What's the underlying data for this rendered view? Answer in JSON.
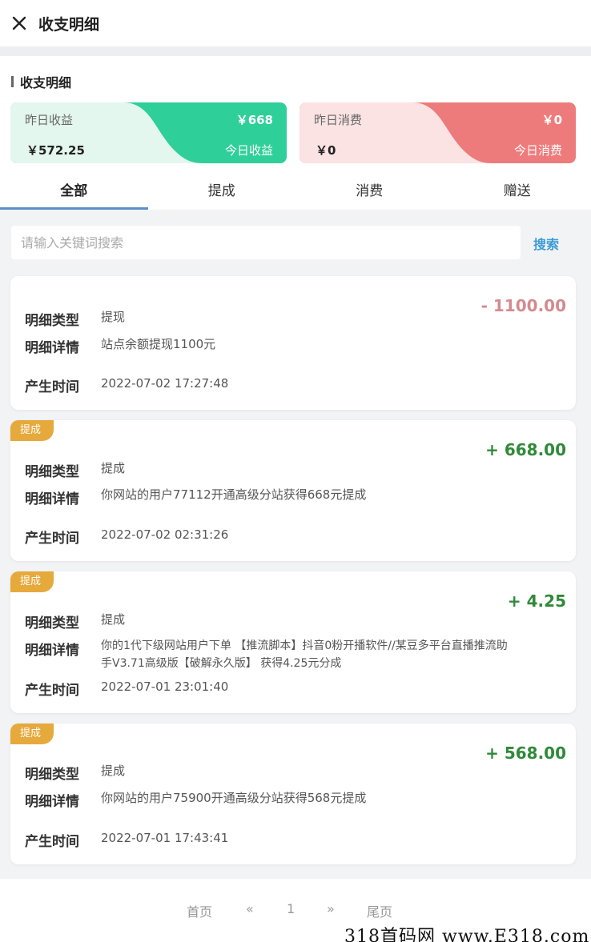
{
  "header": {
    "title": "收支明细",
    "close_icon": "close-icon"
  },
  "summary": {
    "section_title": "收支明细",
    "income_card": {
      "yesterday_label": "昨日收益",
      "yesterday_value": "￥572.25",
      "today_value": "￥668",
      "today_label": "今日收益",
      "color": "#2fcf99"
    },
    "expense_card": {
      "yesterday_label": "昨日消费",
      "yesterday_value": "￥0",
      "today_value": "￥0",
      "today_label": "今日消费",
      "color": "#ee7b7b"
    }
  },
  "tabs": [
    {
      "label": "全部",
      "active": true
    },
    {
      "label": "提成",
      "active": false
    },
    {
      "label": "消费",
      "active": false
    },
    {
      "label": "赠送",
      "active": false
    }
  ],
  "search": {
    "placeholder": "请输入关键词搜索",
    "value": "",
    "button_label": "搜索"
  },
  "field_labels": {
    "type": "明细类型",
    "detail": "明细详情",
    "time": "产生时间"
  },
  "records": [
    {
      "tag": "",
      "amount": "- 1100.00",
      "type": "提现",
      "detail": "站点余额提现1100元",
      "time": "2022-07-02 17:27:48"
    },
    {
      "tag": "提成",
      "amount": "+ 668.00",
      "type": "提成",
      "detail": "你网站的用户77112开通高级分站获得668元提成",
      "time": "2022-07-02 02:31:26"
    },
    {
      "tag": "提成",
      "amount": "+ 4.25",
      "type": "提成",
      "detail_line1": "你的1代下级网站用户下单 【推流脚本】抖音0粉开播软件//某豆多平台直播推流助",
      "detail_line2": "手V3.71高级版【破解永久版】 获得4.25元分成",
      "time": "2022-07-01 23:01:40"
    },
    {
      "tag": "提成",
      "amount": "+ 568.00",
      "type": "提成",
      "detail": "你网站的用户75900开通高级分站获得568元提成",
      "time": "2022-07-01 17:43:41"
    }
  ],
  "pager": {
    "first": "首页",
    "prev": "«",
    "page": "1",
    "next": "»",
    "last": "尾页"
  },
  "watermark": "318首码网 www.E318.com"
}
